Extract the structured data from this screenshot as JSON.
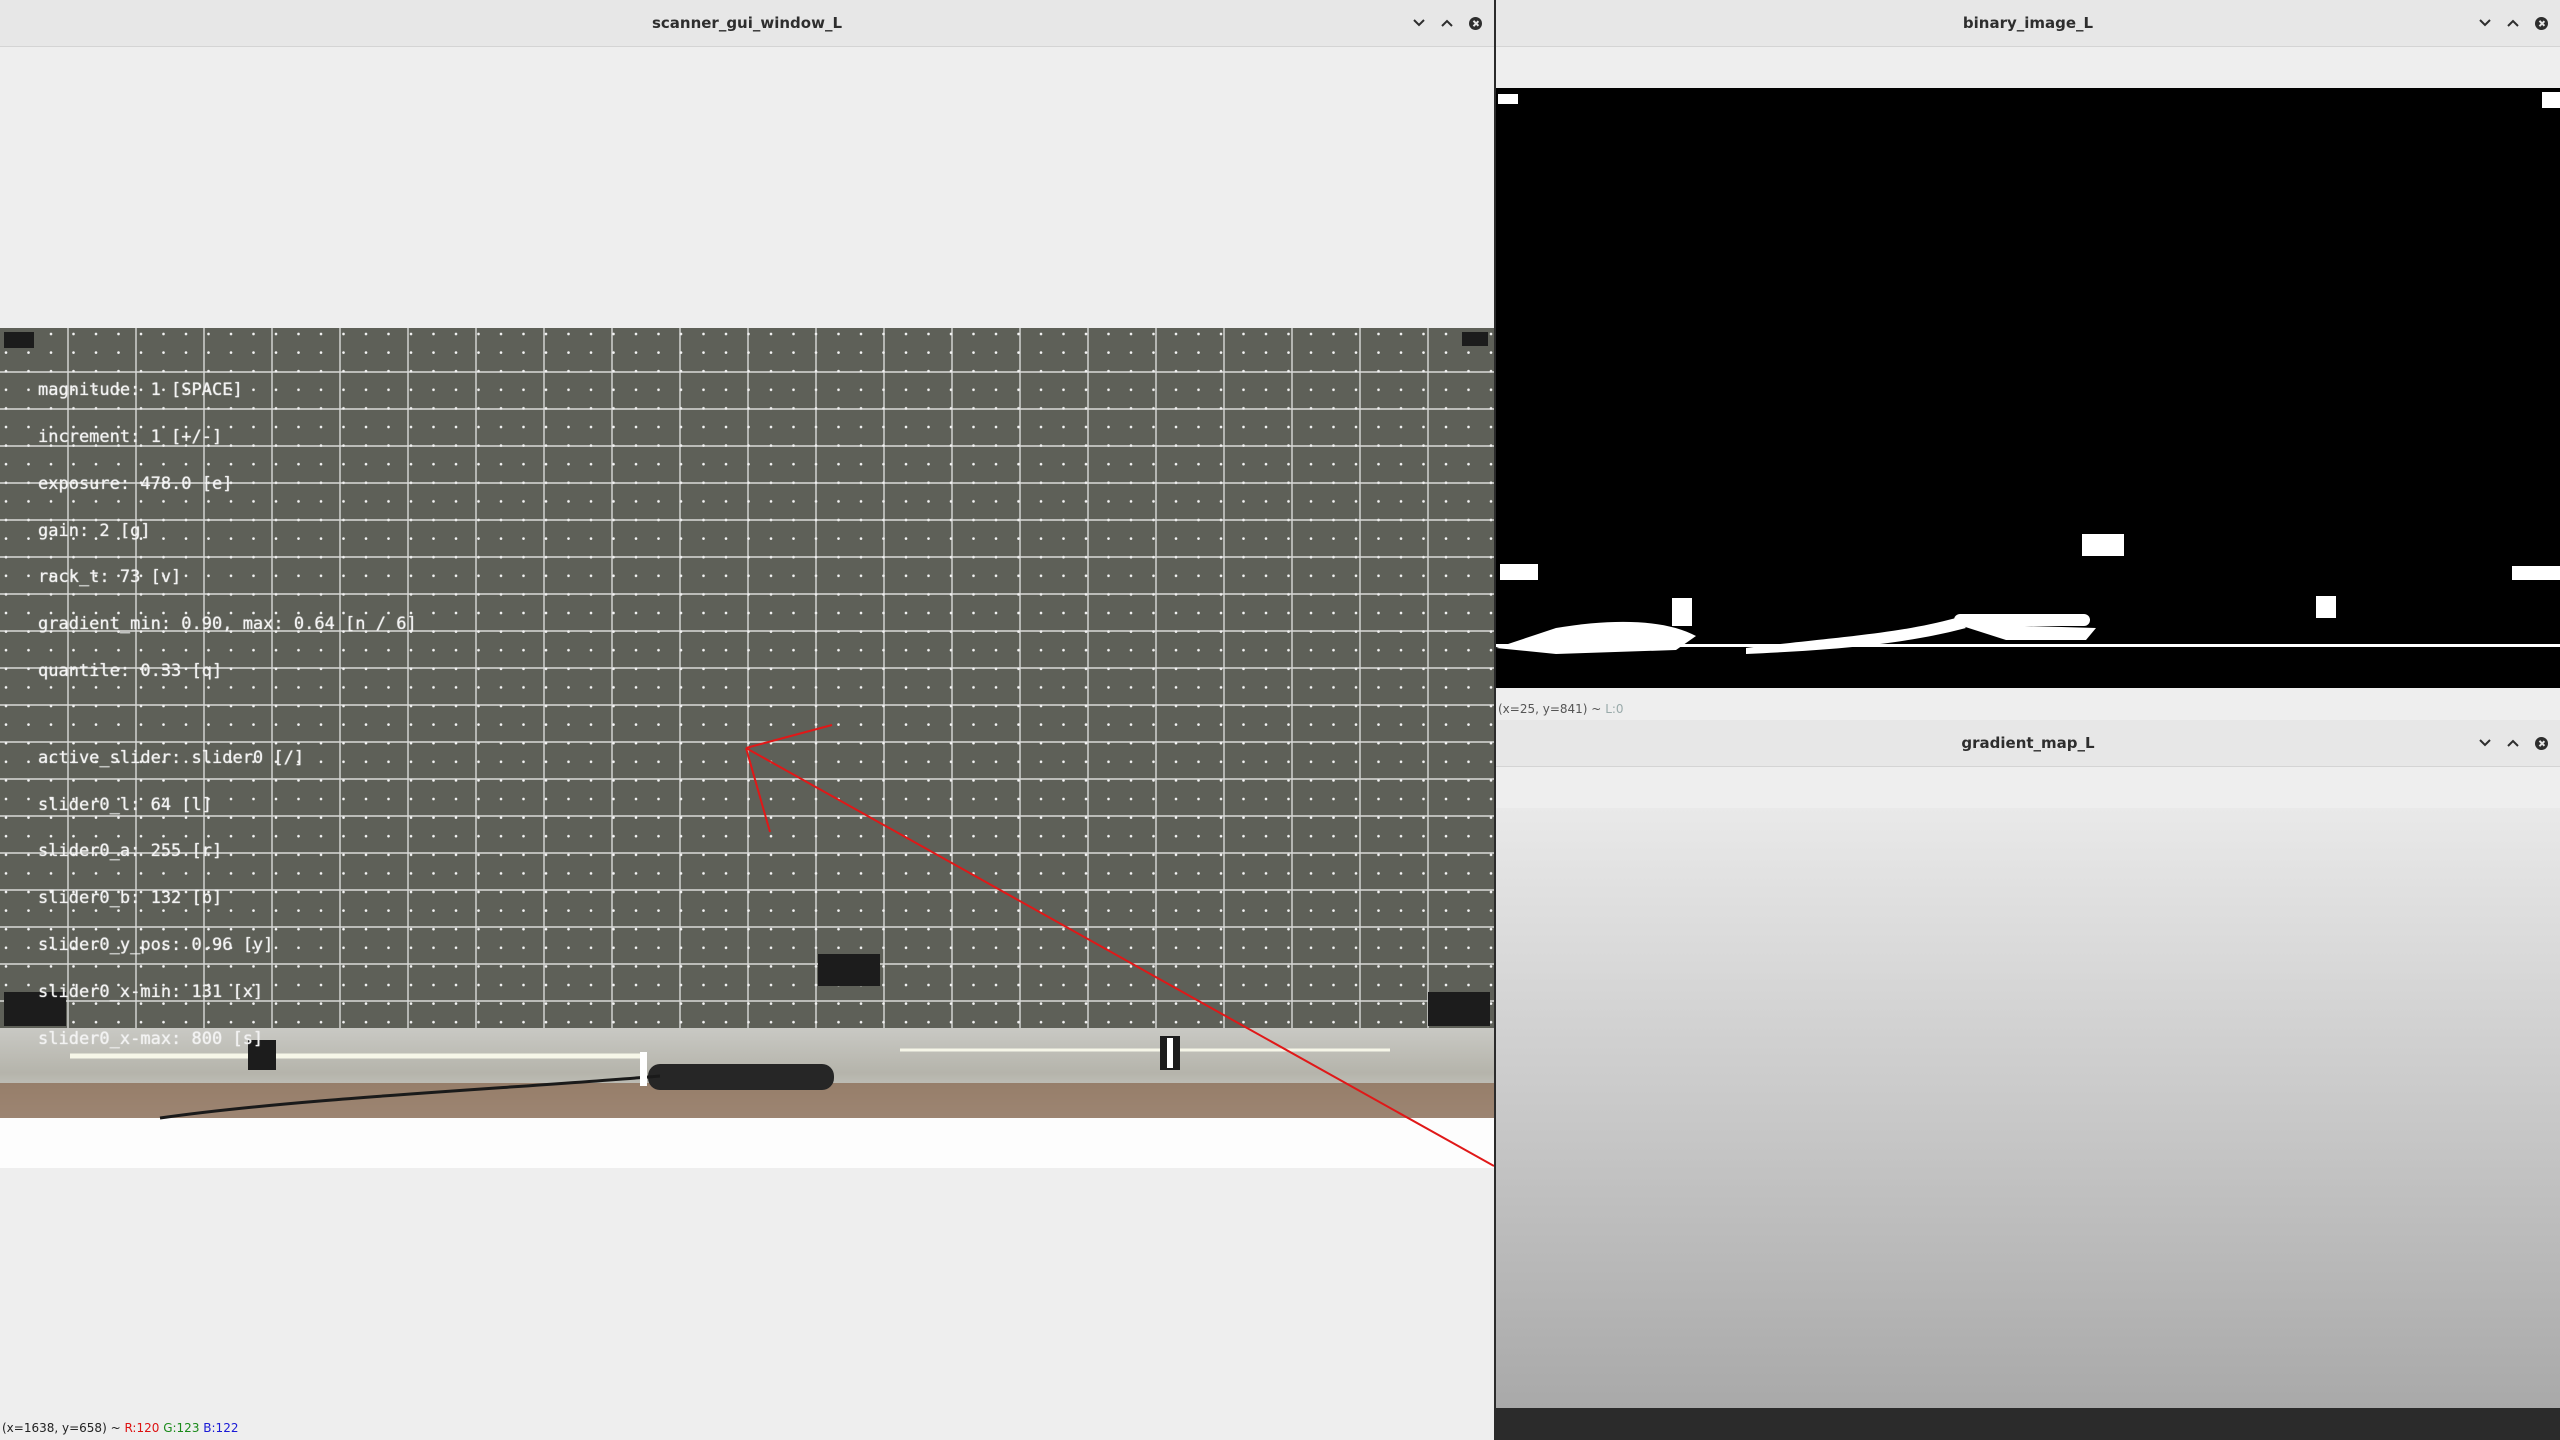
{
  "windows": {
    "scanner": {
      "title": "scanner_gui_window_L",
      "status": {
        "coords": "(x=1638, y=658) ~",
        "r": "R:120",
        "g": "G:123",
        "b": "B:122"
      },
      "overlay_lines": [
        "magnitude: 1 [SPACE]",
        "increment: 1 [+/-]",
        "exposure: 478.0 [e]",
        "gain: 2 [g]",
        "rack_t: 73 [v]",
        "gradient_min: 0.90, max: 0.64 [n / 6]",
        "quantile: 0.33 [q]"
      ],
      "slider_lines": [
        "active_slider: slider0 [/]",
        "slider0_l: 64 [l]",
        "slider0_a: 255 [r]",
        "slider0_b: 132 [b]",
        "slider0_y_pos: 0.96 [y]",
        "slider0_x-min: 131 [x]",
        "slider0_x-max: 800 [s]"
      ]
    },
    "binary": {
      "title": "binary_image_L",
      "status": {
        "coords": "(x=25, y=841) ~",
        "l": "L:0"
      }
    },
    "gradient": {
      "title": "gradient_map_L"
    }
  },
  "icons": {
    "minimize": "chevron-down-icon",
    "maximize": "chevron-up-icon",
    "close": "close-icon"
  },
  "colors": {
    "annotation": "#e01818",
    "grid_line": "#ffffff",
    "camera_bg": "#5f6159"
  }
}
